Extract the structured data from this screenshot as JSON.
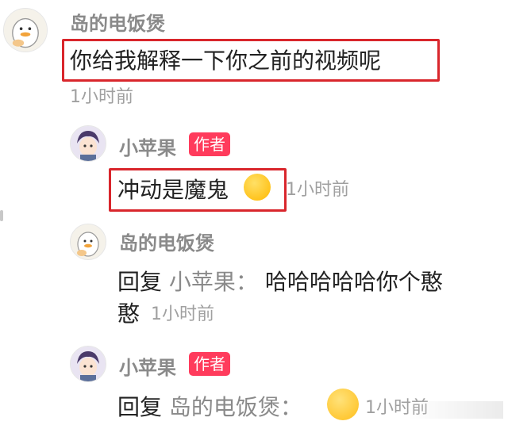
{
  "comment": {
    "author": "岛的电饭煲",
    "text": "你给我解释一下你之前的视频呢",
    "time": "1小时前"
  },
  "replies": [
    {
      "author": "小苹果",
      "badge": "作者",
      "text": "冲动是魔鬼",
      "time": "1小时前"
    },
    {
      "author": "岛的电饭煲",
      "reply_keyword": "回复",
      "reply_target": "小苹果：",
      "text_line1": "哈哈哈哈哈你个憨",
      "text_line2": "憨",
      "time": "1小时前"
    },
    {
      "author": "小苹果",
      "badge": "作者",
      "reply_keyword": "回复",
      "reply_target": "岛的电饭煲：",
      "time": "1小时前"
    }
  ],
  "colors": {
    "highlight_border": "#d9262c",
    "author_badge": "#ff3b5c",
    "muted_text": "#8a8a8a"
  },
  "icons": {
    "laugh_emoji": "rolling-laughing-emoji",
    "shush_emoji": "shushing-face-emoji"
  }
}
